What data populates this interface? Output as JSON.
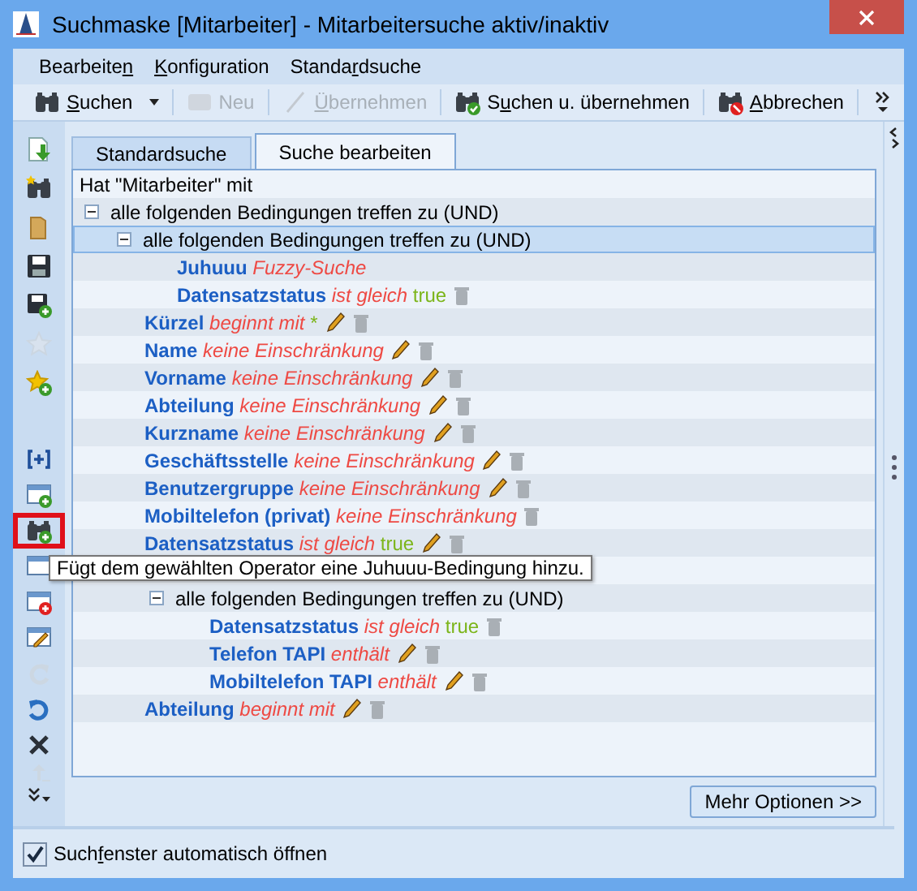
{
  "window": {
    "title": "Suchmaske [Mitarbeiter] - Mitarbeitersuche aktiv/inaktiv"
  },
  "menu": [
    {
      "label": {
        "pre": "Bearbeite",
        "key": "n"
      }
    },
    {
      "label": {
        "key": "K",
        "post": "onfiguration"
      }
    },
    {
      "label": {
        "pre": "Standa",
        "key": "r",
        "post": "dsuche"
      }
    }
  ],
  "toolbar": [
    {
      "kind": "binoculars",
      "label": {
        "key": "S",
        "post": "uchen"
      },
      "disabled": false,
      "dropdown": true
    },
    {
      "kind": "card",
      "label": {
        "post": "Neu"
      },
      "disabled": true,
      "dropdown": false
    },
    {
      "kind": "pen",
      "label": {
        "key": "Ü",
        "post": "bernehmen"
      },
      "disabled": true,
      "dropdown": false
    },
    {
      "kind": "binoculars-check",
      "label": {
        "pre": "S",
        "key": "u",
        "post": "chen u. übernehmen"
      },
      "disabled": false,
      "dropdown": false
    },
    {
      "kind": "binoculars-stop",
      "label": {
        "key": "A",
        "post": "bbrechen"
      },
      "disabled": false,
      "dropdown": false
    }
  ],
  "sidebar": [
    {
      "kind": "import",
      "disabled": false,
      "selected": false
    },
    {
      "kind": "binoculars-star",
      "disabled": false,
      "selected": false
    },
    {
      "kind": "folder",
      "disabled": false,
      "selected": false
    },
    {
      "kind": "save",
      "disabled": false,
      "selected": false
    },
    {
      "kind": "save-add",
      "disabled": false,
      "selected": false
    },
    {
      "kind": "star",
      "disabled": true,
      "selected": false
    },
    {
      "kind": "star-add",
      "disabled": false,
      "selected": false
    },
    {
      "kind": "gap"
    },
    {
      "kind": "bracket-plus",
      "disabled": false,
      "selected": false
    },
    {
      "kind": "window-add",
      "disabled": false,
      "selected": false
    },
    {
      "kind": "binoculars-add",
      "disabled": false,
      "selected": true
    },
    {
      "kind": "window",
      "disabled": false,
      "selected": false
    },
    {
      "kind": "window-remove",
      "disabled": false,
      "selected": false
    },
    {
      "kind": "window-edit",
      "disabled": false,
      "selected": false
    },
    {
      "kind": "redo",
      "disabled": true,
      "selected": false
    },
    {
      "kind": "undo",
      "disabled": false,
      "selected": false
    },
    {
      "kind": "delete",
      "disabled": false,
      "selected": false
    },
    {
      "kind": "up",
      "disabled": true,
      "selected": false
    },
    {
      "kind": "more",
      "disabled": false,
      "selected": false
    }
  ],
  "tabs": [
    {
      "label": "Standardsuche",
      "selected": false
    },
    {
      "label": "Suche bearbeiten",
      "selected": true
    }
  ],
  "tree": [
    {
      "kind": "header",
      "text": "Hat \"Mitarbeiter\" mit",
      "selected": false
    },
    {
      "kind": "group",
      "text": "alle folgenden Bedingungen treffen zu (UND)",
      "expanded": true,
      "selected": false,
      "children": [
        {
          "kind": "group",
          "text": "alle folgenden Bedingungen treffen zu (UND)",
          "expanded": true,
          "selected": true,
          "children": [
            {
              "kind": "condition",
              "field": "Juhuuu",
              "operator": "Fuzzy-Suche",
              "editable": false,
              "deletable": false,
              "selected": false
            },
            {
              "kind": "condition",
              "field": "Datensatzstatus",
              "operator": "ist gleich",
              "value": "true",
              "editable": false,
              "deletable": true,
              "selected": false
            }
          ]
        },
        {
          "kind": "condition",
          "field": "Kürzel",
          "operator": "beginnt mit",
          "value": "*",
          "editable": true,
          "deletable": true,
          "selected": false
        },
        {
          "kind": "condition",
          "field": "Name",
          "operator": "keine Einschränkung",
          "editable": true,
          "deletable": true,
          "selected": false
        },
        {
          "kind": "condition",
          "field": "Vorname",
          "operator": "keine Einschränkung",
          "editable": true,
          "deletable": true,
          "selected": false
        },
        {
          "kind": "condition",
          "field": "Abteilung",
          "operator": "keine Einschränkung",
          "editable": true,
          "deletable": true,
          "selected": false
        },
        {
          "kind": "condition",
          "field": "Kurzname",
          "operator": "keine Einschränkung",
          "editable": true,
          "deletable": true,
          "selected": false
        },
        {
          "kind": "condition",
          "field": "Geschäftsstelle",
          "operator": "keine Einschränkung",
          "editable": true,
          "deletable": true,
          "selected": false
        },
        {
          "kind": "condition",
          "field": "Benutzergruppe",
          "operator": "keine Einschränkung",
          "editable": true,
          "deletable": true,
          "selected": false
        },
        {
          "kind": "condition",
          "field": "Mobiltelefon (privat)",
          "operator": "keine Einschränkung",
          "editable": false,
          "deletable": true,
          "selected": false
        },
        {
          "kind": "condition",
          "field": "Datensatzstatus",
          "operator": "ist gleich",
          "value": "true",
          "editable": true,
          "deletable": true,
          "selected": false
        },
        {
          "kind": "relation",
          "children": [
            {
              "kind": "group",
              "text": "alle folgenden Bedingungen treffen zu (UND)",
              "expanded": true,
              "selected": false,
              "children": [
                {
                  "kind": "condition",
                  "field": "Datensatzstatus",
                  "operator": "ist gleich",
                  "value": "true",
                  "editable": false,
                  "deletable": true,
                  "selected": false
                },
                {
                  "kind": "condition",
                  "field": "Telefon TAPI",
                  "operator": "enthält",
                  "editable": true,
                  "deletable": true,
                  "selected": false
                },
                {
                  "kind": "condition",
                  "field": "Mobiltelefon TAPI",
                  "operator": "enthält",
                  "editable": true,
                  "deletable": true,
                  "selected": false
                }
              ]
            }
          ]
        },
        {
          "kind": "condition",
          "field": "Abteilung",
          "operator": "beginnt mit",
          "editable": true,
          "deletable": true,
          "selected": false
        }
      ]
    }
  ],
  "tooltip": "Fügt dem gewählten Operator eine Juhuuu-Bedingung hinzu.",
  "more_button": "Mehr Optionen >>",
  "auto_open": {
    "label": {
      "pre": "Such",
      "key": "f",
      "post": "enster automatisch öffnen"
    },
    "checked": true
  }
}
